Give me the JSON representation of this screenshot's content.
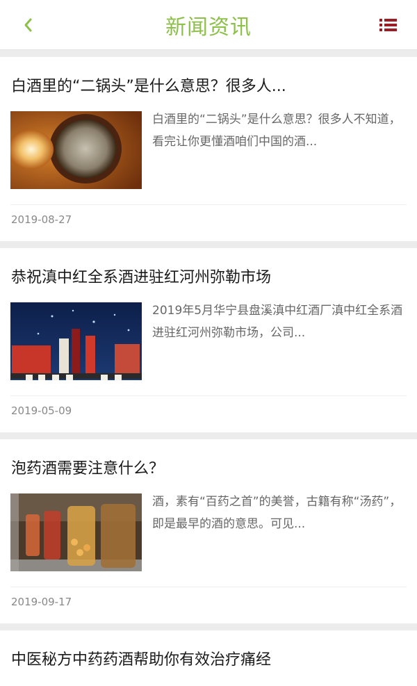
{
  "header": {
    "title": "新闻资讯",
    "back_icon": "chevron-left-icon",
    "menu_icon": "list-menu-icon",
    "accent_color": "#8cc04a",
    "menu_color": "#9b1c24"
  },
  "articles": [
    {
      "title": "白酒里的“二锅头”是什么意思？很多人...",
      "summary": "白酒里的“二锅头”是什么意思？很多人不知道，看完让你更懂酒咱们中国的酒...",
      "date": "2019-08-27"
    },
    {
      "title": "恭祝滇中红全系酒进驻红河州弥勒市场",
      "summary": "2019年5月华宁县盘溪滇中红酒厂滇中红全系酒进驻红河州弥勒市场，公司...",
      "date": "2019-05-09"
    },
    {
      "title": "泡药酒需要注意什么？",
      "summary": "酒，素有“百药之首”的美誉，古籍有称“汤药”，即是最早的酒的意思。可见...",
      "date": "2019-09-17"
    },
    {
      "title": "中医秘方中药药酒帮助你有效治疗痛经"
    }
  ]
}
